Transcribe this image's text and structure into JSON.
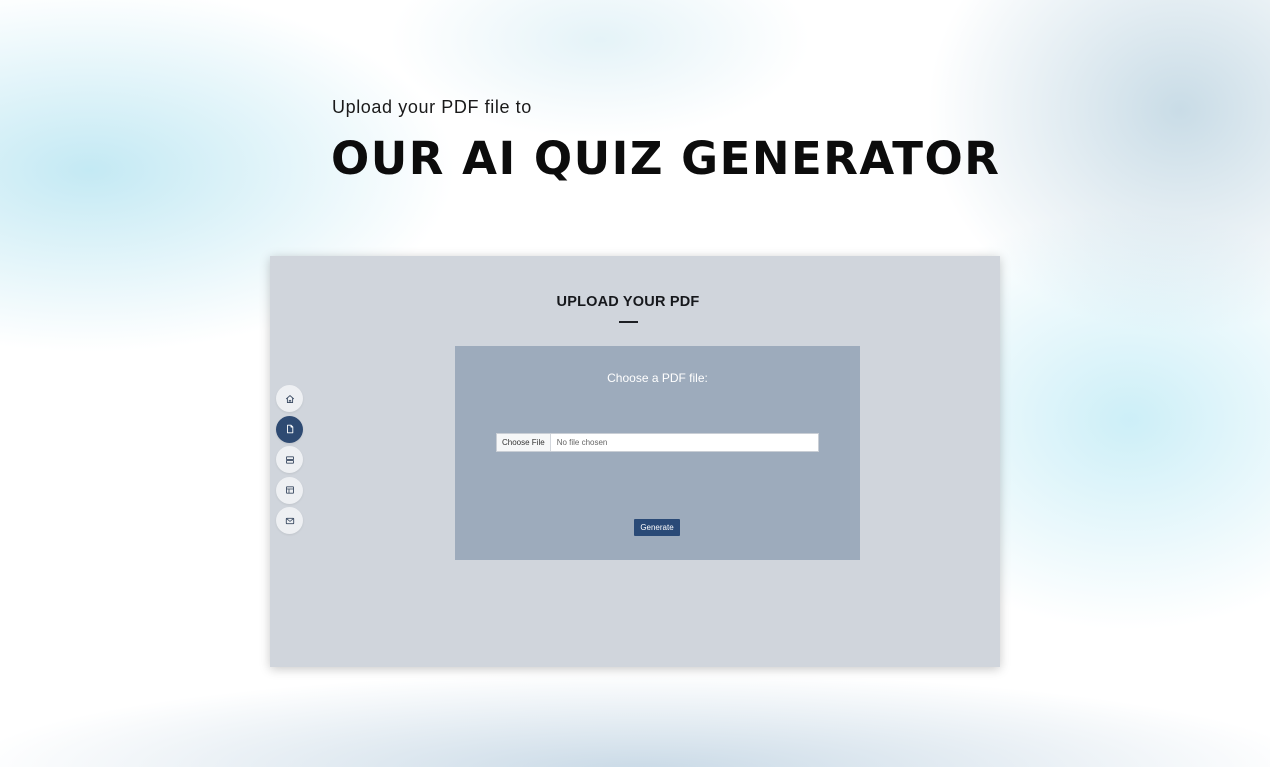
{
  "hero": {
    "subtitle": "Upload your PDF file to",
    "title": "OUR AI QUIZ GENERATOR"
  },
  "app": {
    "heading": "UPLOAD YOUR PDF",
    "panel": {
      "label": "Choose a PDF file:",
      "choose_button": "Choose File",
      "file_status": "No file chosen",
      "generate_button": "Generate"
    },
    "nav": [
      {
        "icon": "home-icon",
        "active": false
      },
      {
        "icon": "document-icon",
        "active": true
      },
      {
        "icon": "server-icon",
        "active": false
      },
      {
        "icon": "layout-icon",
        "active": false
      },
      {
        "icon": "mail-icon",
        "active": false
      }
    ]
  },
  "colors": {
    "accent": "#2a4a77",
    "app_background": "#d0d5dc",
    "panel_background": "#9dabbc"
  }
}
